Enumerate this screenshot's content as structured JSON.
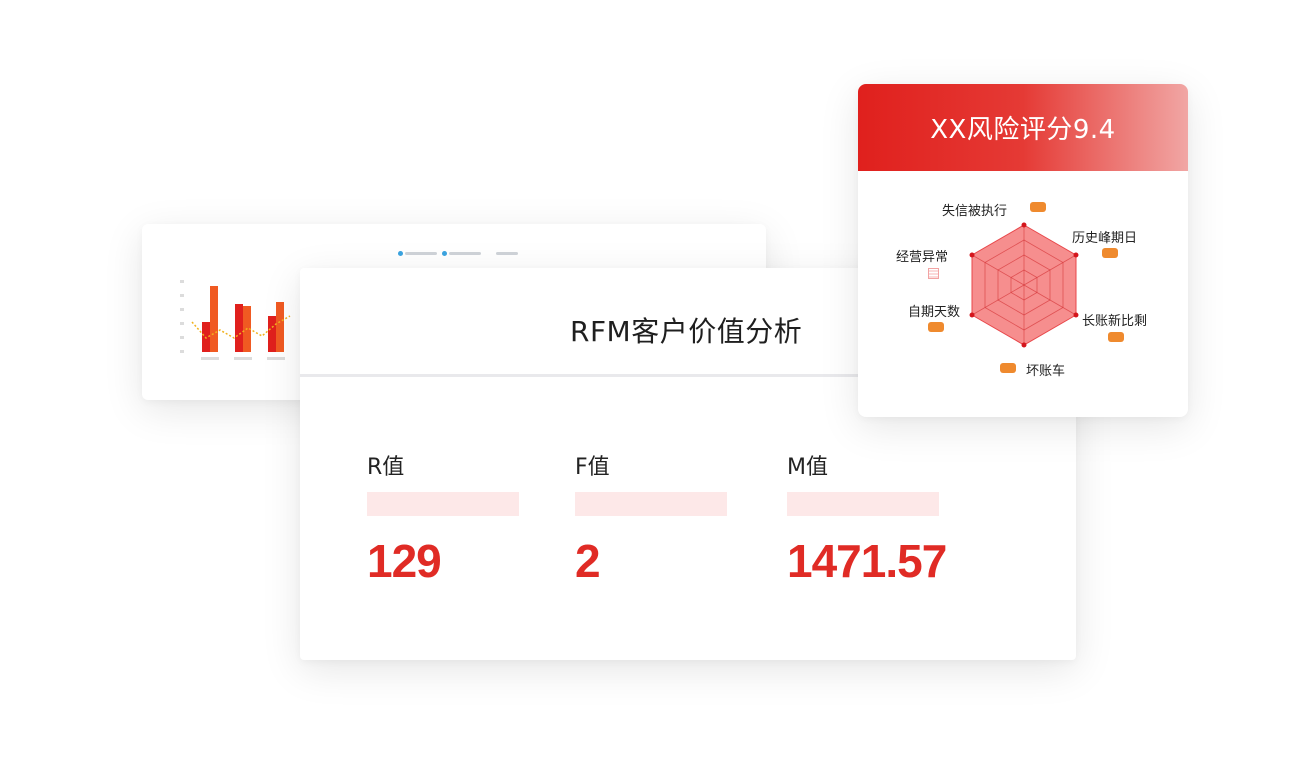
{
  "rfm": {
    "title": "RFM客户价值分析",
    "metrics": [
      {
        "label": "R值",
        "value": "129"
      },
      {
        "label": "F值",
        "value": "2"
      },
      {
        "label": "M值",
        "value": "1471.57"
      }
    ]
  },
  "risk": {
    "title": "XX风险评分9.4",
    "radar_labels": [
      "失信被执行",
      "历史峰期日",
      "长账新比剩",
      "坏账车",
      "自期天数",
      "经营异常"
    ]
  },
  "colors": {
    "accent_red": "#e02b25",
    "bar_red": "#e0201d",
    "bar_orange": "#f05a22",
    "tag_orange": "#ef8a2e",
    "radar_fill": "#f47a7a",
    "metric_bar_bg": "#fde8e8"
  },
  "chart_data": {
    "type": "bar",
    "categories": [
      "",
      "",
      ""
    ],
    "series": [
      {
        "values": [
          30,
          48,
          36
        ]
      },
      {
        "values": [
          66,
          46,
          50
        ]
      }
    ],
    "line": [
      30,
      14,
      22,
      14,
      24,
      16,
      28,
      36
    ],
    "title": "",
    "xlabel": "",
    "ylabel": "",
    "ylim": [
      0,
      70
    ]
  }
}
